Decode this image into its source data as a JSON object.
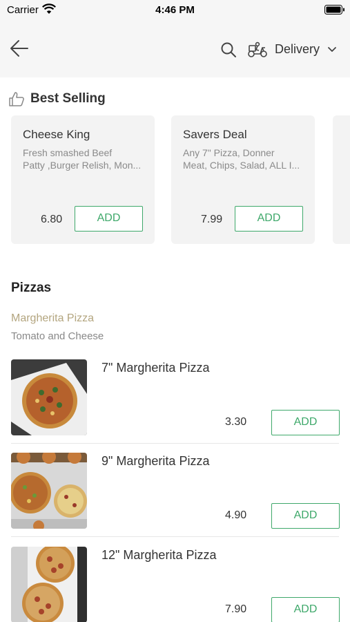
{
  "status_bar": {
    "carrier": "Carrier",
    "time": "4:46 PM"
  },
  "header": {
    "delivery_label": "Delivery",
    "icons": [
      "back-arrow-icon",
      "search-icon",
      "scooter-icon",
      "chevron-down-icon"
    ]
  },
  "best_selling": {
    "title": "Best Selling",
    "cards": [
      {
        "title": "Cheese King",
        "desc_line1": "Fresh smashed Beef",
        "desc_line2": "Patty ,Burger Relish, Mon...",
        "price": "6.80",
        "add_label": "ADD"
      },
      {
        "title": "Savers Deal",
        "desc_line1": "Any 7\" Pizza, Donner",
        "desc_line2": "Meat, Chips, Salad, ALL I...",
        "price": "7.99",
        "add_label": "ADD"
      }
    ]
  },
  "menu": {
    "section_title": "Pizzas",
    "category_name": "Margherita Pizza",
    "category_desc": "Tomato and Cheese",
    "items": [
      {
        "name": "7\" Margherita Pizza",
        "price": "3.30",
        "add_label": "ADD"
      },
      {
        "name": "9\" Margherita Pizza",
        "price": "4.90",
        "add_label": "ADD"
      },
      {
        "name": "12\" Margherita Pizza",
        "price": "7.90",
        "add_label": "ADD"
      }
    ]
  },
  "colors": {
    "accent_green": "#3ea86a",
    "category_gold": "#b3a57f",
    "header_bg": "#f6f6f6",
    "card_bg": "#f3f3f3"
  }
}
